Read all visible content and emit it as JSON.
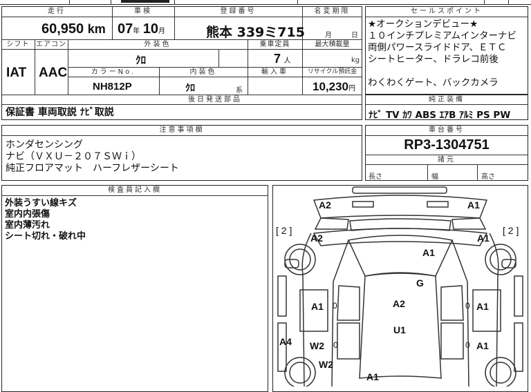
{
  "top_row": {
    "headers": [
      "走行",
      "車検",
      "登録番号",
      "名変期限"
    ],
    "mileage": "60,950",
    "mileage_unit": "km",
    "inspection_year": "07",
    "year_unit": "年",
    "inspection_month": "10",
    "month_unit": "月",
    "registration": "熊本 339ミ715",
    "name_change_month": "月",
    "name_change_day": "日"
  },
  "sales_points": {
    "header": "セールスポイント",
    "lines": [
      "★オークションデビュー★",
      "１０インチプレミアムインターナビ",
      "両側パワースライドドア、ＥＴＣ",
      "シートヒーター、ドラレコ前後",
      "",
      "わくわくゲート、バックカメラ"
    ]
  },
  "spec_row": {
    "shift_header": "シフト",
    "ac_header": "エアコン",
    "exterior_header": "外装色",
    "capacity_header": "乗車定員",
    "max_load_header": "最大積載量",
    "shift": "IAT",
    "ac": "AAC",
    "exterior_color": "ｸﾛ",
    "capacity": "7",
    "capacity_unit": "人",
    "load_unit": "kg",
    "color_no_header": "カラーNo.",
    "interior_header": "内装色",
    "import_header": "輸入車",
    "recycle_header": "リサイクル預託金",
    "color_no": "NH812P",
    "interior_color": "ｸﾛ",
    "interior_suffix": "系",
    "recycle_fee": "10,230",
    "recycle_unit": "円"
  },
  "later_parts": {
    "header": "後日発送部品",
    "text": "保証書 車両取説 ﾅﾋﾞ取説"
  },
  "equipment": {
    "header": "純正装備",
    "items": "ﾅﾋﾞ TV ｶﾜ ABS ｴｱB ｱﾙﾐ PS PW"
  },
  "notes": {
    "header": "注意事項欄",
    "lines": [
      "ホンダセンシング",
      "ナビ（ＶＸＵ－２０７ＳＷｉ）",
      "純正フロアマット　ハーフレザーシート"
    ]
  },
  "chassis": {
    "header": "車台番号",
    "number": "RP3-1304751",
    "dims_header": "諸元",
    "length_label": "長さ",
    "width_label": "幅",
    "height_label": "高さ"
  },
  "inspector": {
    "header": "検査員記入欄",
    "lines": [
      "外装うすい線キズ",
      "室内内張傷",
      "室内薄汚れ",
      "シート切れ・破れ中"
    ]
  },
  "damage_map": {
    "marks": {
      "a2_front_left": "A2",
      "a1_front_right": "A1",
      "bracket_left": "[ 2 ]",
      "bracket_right": "[ 2 ]",
      "a2_left_fender": "A2",
      "a1_right_fender": "A1",
      "a1_hood": "A1",
      "g_windshield": "G",
      "a1_left_door": "A1",
      "zero_left_door": "0",
      "a2_roof": "A2",
      "zero_right_door": "0",
      "a1_right_door": "A1",
      "u1_roof": "U1",
      "a4_left_rear": "A4",
      "w2_left_rear": "W2",
      "zero_left_rear": "0",
      "zero_right_rear": "0",
      "a1_right_rear": "A1",
      "w2_rear_lower": "W2",
      "a1_rear": "A1"
    }
  }
}
